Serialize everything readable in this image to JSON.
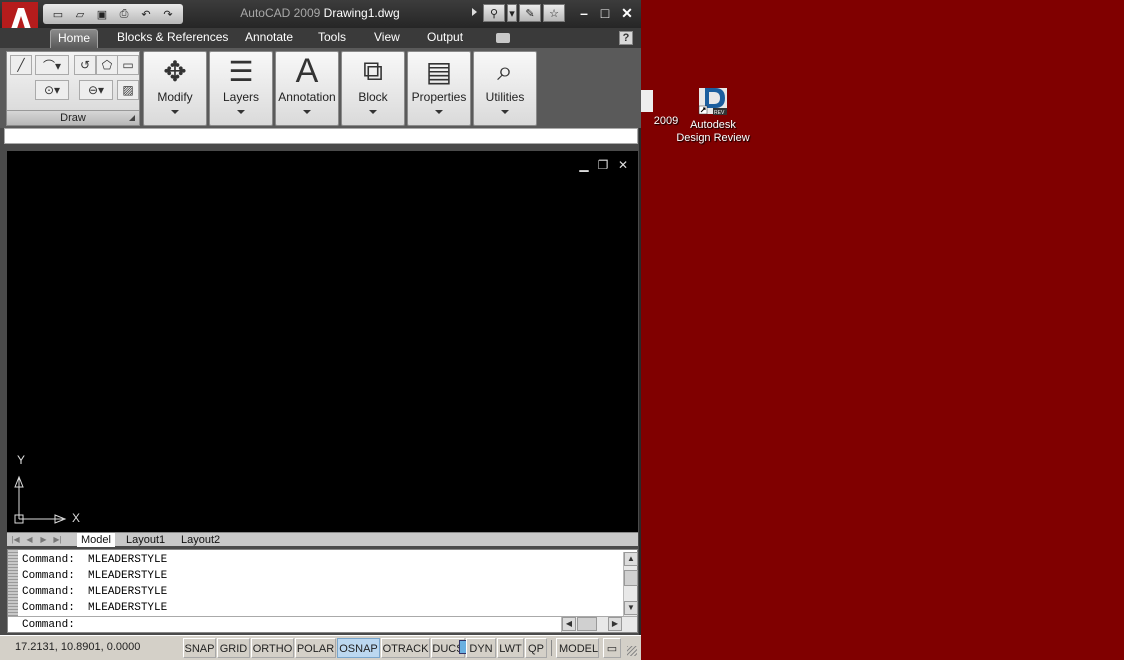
{
  "window": {
    "title_app": "AutoCAD 2009",
    "title_doc": "Drawing1.dwg"
  },
  "ribbon": {
    "tabs": [
      {
        "label": "Home"
      },
      {
        "label": "Blocks & References"
      },
      {
        "label": "Annotate"
      },
      {
        "label": "Tools"
      },
      {
        "label": "View"
      },
      {
        "label": "Output"
      }
    ],
    "help_label": "?",
    "draw_panel_label": "Draw",
    "panels": [
      {
        "label": "Modify",
        "icon": "move-arrows-icon"
      },
      {
        "label": "Layers",
        "icon": "layers-icon"
      },
      {
        "label": "Annotation",
        "icon": "text-a-icon"
      },
      {
        "label": "Block",
        "icon": "block-icon"
      },
      {
        "label": "Properties",
        "icon": "properties-icon"
      },
      {
        "label": "Utilities",
        "icon": "magnifier-icon"
      }
    ]
  },
  "drawing": {
    "ucs_y": "Y",
    "ucs_x": "X"
  },
  "layout_tabs": [
    "Model",
    "Layout1",
    "Layout2"
  ],
  "command": {
    "history": [
      "Command:  MLEADERSTYLE",
      "Command:  MLEADERSTYLE",
      "Command:  MLEADERSTYLE",
      "Command:  MLEADERSTYLE"
    ],
    "prompt": "Command:"
  },
  "status": {
    "coords": "17.2131, 10.8901, 0.0000",
    "toggles": [
      {
        "label": "SNAP",
        "on": false
      },
      {
        "label": "GRID",
        "on": false
      },
      {
        "label": "ORTHO",
        "on": false
      },
      {
        "label": "POLAR",
        "on": false
      },
      {
        "label": "OSNAP",
        "on": true
      },
      {
        "label": "OTRACK",
        "on": false
      },
      {
        "label": "DUCS",
        "on": false
      },
      {
        "label": "DYN",
        "on": false
      },
      {
        "label": "LWT",
        "on": false
      },
      {
        "label": "QP",
        "on": false
      },
      {
        "label": "MODEL",
        "on": false
      }
    ]
  },
  "desktop": {
    "icons": [
      {
        "label": "2009"
      },
      {
        "label": "Autodesk Design Review"
      }
    ]
  }
}
